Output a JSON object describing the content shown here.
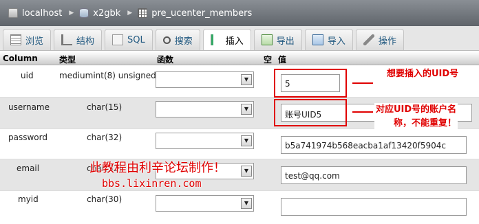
{
  "breadcrumb": {
    "server": "localhost",
    "database": "x2gbk",
    "table": "pre_ucenter_members"
  },
  "tabs": [
    {
      "label": "浏览",
      "icon": "browse-icon"
    },
    {
      "label": "结构",
      "icon": "structure-icon"
    },
    {
      "label": "SQL",
      "icon": "sql-icon"
    },
    {
      "label": "搜索",
      "icon": "search-icon"
    },
    {
      "label": "插入",
      "icon": "insert-icon",
      "active": true
    },
    {
      "label": "导出",
      "icon": "export-icon"
    },
    {
      "label": "导入",
      "icon": "import-icon"
    },
    {
      "label": "操作",
      "icon": "operations-icon"
    }
  ],
  "columns_header": {
    "column": "Column",
    "type": "类型",
    "function": "函数",
    "null": "空",
    "value": "值"
  },
  "rows": [
    {
      "column": "uid",
      "type": "mediumint(8) unsigned",
      "function": "",
      "value": "5"
    },
    {
      "column": "username",
      "type": "char(15)",
      "function": "",
      "value": "账号UID5"
    },
    {
      "column": "password",
      "type": "char(32)",
      "function": "",
      "value": "b5a741974b568eacba1af13420f5904c"
    },
    {
      "column": "email",
      "type": "char(32)",
      "function": "",
      "value": "test@qq.com"
    },
    {
      "column": "myid",
      "type": "char(30)",
      "function": "",
      "value": ""
    }
  ],
  "annotations": {
    "uid_note": "想要插入的UID号",
    "username_note_line1": "对应UID号的账户名",
    "username_note_line2": "称，不能重复！"
  },
  "watermark": {
    "line1": "此教程由利辛论坛制作！",
    "line2": "bbs.lixinren.com"
  },
  "colors": {
    "annotation_red": "#e00000",
    "tab_link": "#235a81"
  }
}
